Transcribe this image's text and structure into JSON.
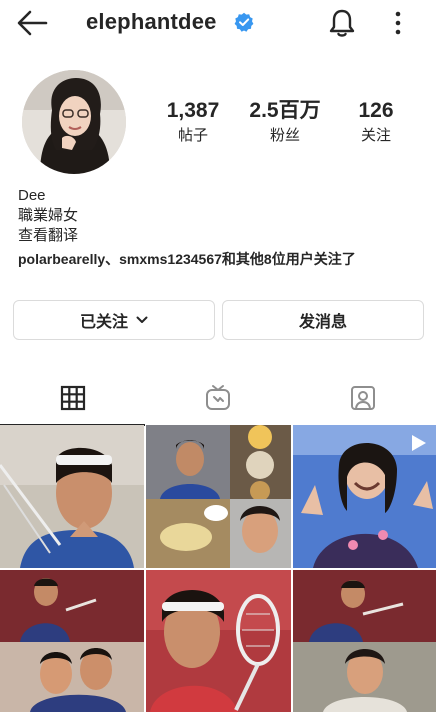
{
  "header": {
    "username": "elephantdee",
    "back_icon": "arrow-left-icon",
    "verified_icon": "verified-badge-icon",
    "bell_icon": "bell-icon",
    "menu_icon": "more-vertical-icon"
  },
  "stats": [
    {
      "value": "1,387",
      "label": "帖子"
    },
    {
      "value": "2.5百万",
      "label": "粉丝"
    },
    {
      "value": "126",
      "label": "关注"
    }
  ],
  "bio": {
    "name": "Dee",
    "description": "職業婦女",
    "translate": "查看翻译",
    "followed_by_names": "polarbearelly、smxms1234567",
    "followed_by_rest": "和其他8位用户关注了"
  },
  "buttons": {
    "following": "已关注",
    "message": "发消息"
  },
  "tabs": [
    {
      "name": "posts",
      "icon": "grid-icon"
    },
    {
      "name": "igtv",
      "icon": "igtv-icon"
    },
    {
      "name": "tagged",
      "icon": "tagged-user-icon"
    }
  ],
  "colors": {
    "verified": "#3897f0",
    "text": "#262626",
    "border": "#dbdbdb"
  }
}
